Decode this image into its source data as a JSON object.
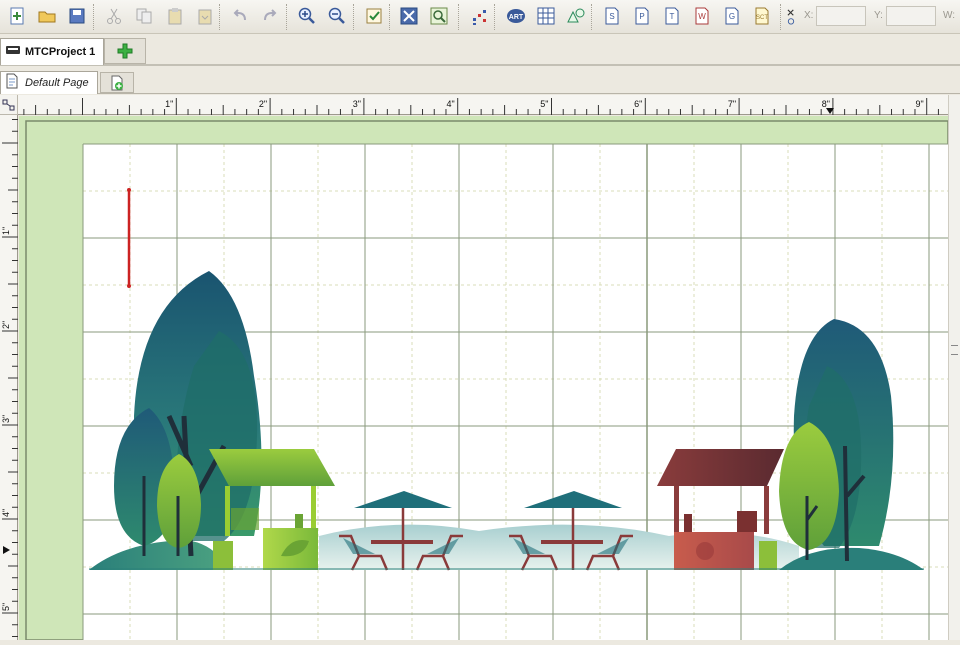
{
  "toolbar": {
    "buttons": [
      {
        "name": "new-file-icon"
      },
      {
        "name": "open-folder-icon"
      },
      {
        "name": "save-icon"
      },
      {
        "name": "cut-icon"
      },
      {
        "name": "copy-icon"
      },
      {
        "name": "paste-icon"
      },
      {
        "name": "paste-special-icon"
      },
      {
        "name": "undo-icon"
      },
      {
        "name": "redo-icon"
      },
      {
        "name": "zoom-in-icon"
      },
      {
        "name": "zoom-out-icon"
      },
      {
        "name": "check-icon"
      },
      {
        "name": "tools-icon"
      },
      {
        "name": "find-icon"
      },
      {
        "name": "grid-dots-icon"
      },
      {
        "name": "art-icon"
      },
      {
        "name": "table-grid-icon"
      },
      {
        "name": "shapes-icon"
      },
      {
        "name": "import-s-icon"
      },
      {
        "name": "import-p-icon"
      },
      {
        "name": "import-t-icon"
      },
      {
        "name": "import-w-icon"
      },
      {
        "name": "import-g-icon"
      },
      {
        "name": "import-sct-icon"
      }
    ],
    "art_label": "ART",
    "coords": {
      "x_label": "X:",
      "y_label": "Y:",
      "w_label": "W:"
    }
  },
  "project_tab": {
    "label": "MTCProject 1"
  },
  "page_tab": {
    "label": "Default Page"
  },
  "ruler": {
    "horizontal_labels": [
      "1\"",
      "2\"",
      "3\"",
      "4\"",
      "5\"",
      "6\"",
      "7\"",
      "8\"",
      "9\""
    ],
    "vertical_labels": [
      "1\"",
      "2\"",
      "3\"",
      "4\"",
      "5\""
    ]
  },
  "colors": {
    "page_margin": "#cfe6b8",
    "grid_major": "#8a9a7c",
    "grid_minor": "#d8dcb8",
    "tree_dark": "#1f5a6e",
    "tree_teal": "#2a7f7a",
    "tree_green": "#8cbf3a",
    "kiosk_green": "#9acd32",
    "kiosk_red": "#c96a5a",
    "umbrella": "#1f6f7a",
    "chair": "#8a3a3a",
    "guide_red": "#cc2222"
  }
}
